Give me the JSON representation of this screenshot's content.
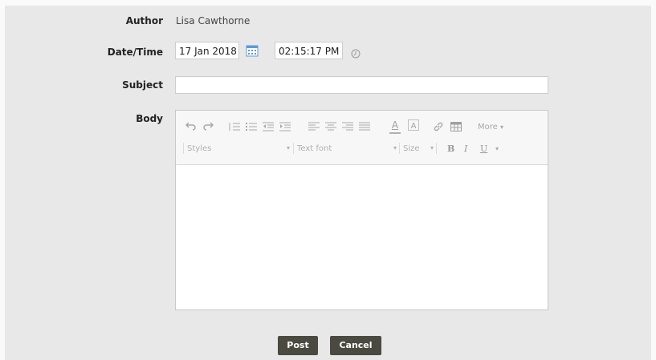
{
  "form": {
    "author_label": "Author",
    "author_value": "Lisa Cawthorne",
    "datetime_label": "Date/Time",
    "date_value": "17 Jan 2018",
    "time_value": "02:15:17 PM",
    "subject_label": "Subject",
    "subject_value": "",
    "body_label": "Body"
  },
  "editor": {
    "more_label": "More",
    "styles_label": "Styles",
    "font_label": "Text font",
    "size_label": "Size",
    "bold_label": "B",
    "italic_label": "I",
    "underline_label": "U",
    "font_color_label": "A",
    "bg_color_label": "A"
  },
  "actions": {
    "post_label": "Post",
    "cancel_label": "Cancel"
  },
  "colors": {
    "page_bg": "#e8e8e8",
    "button_bg": "#4a4a40",
    "calendar_accent": "#5b9bd5"
  }
}
